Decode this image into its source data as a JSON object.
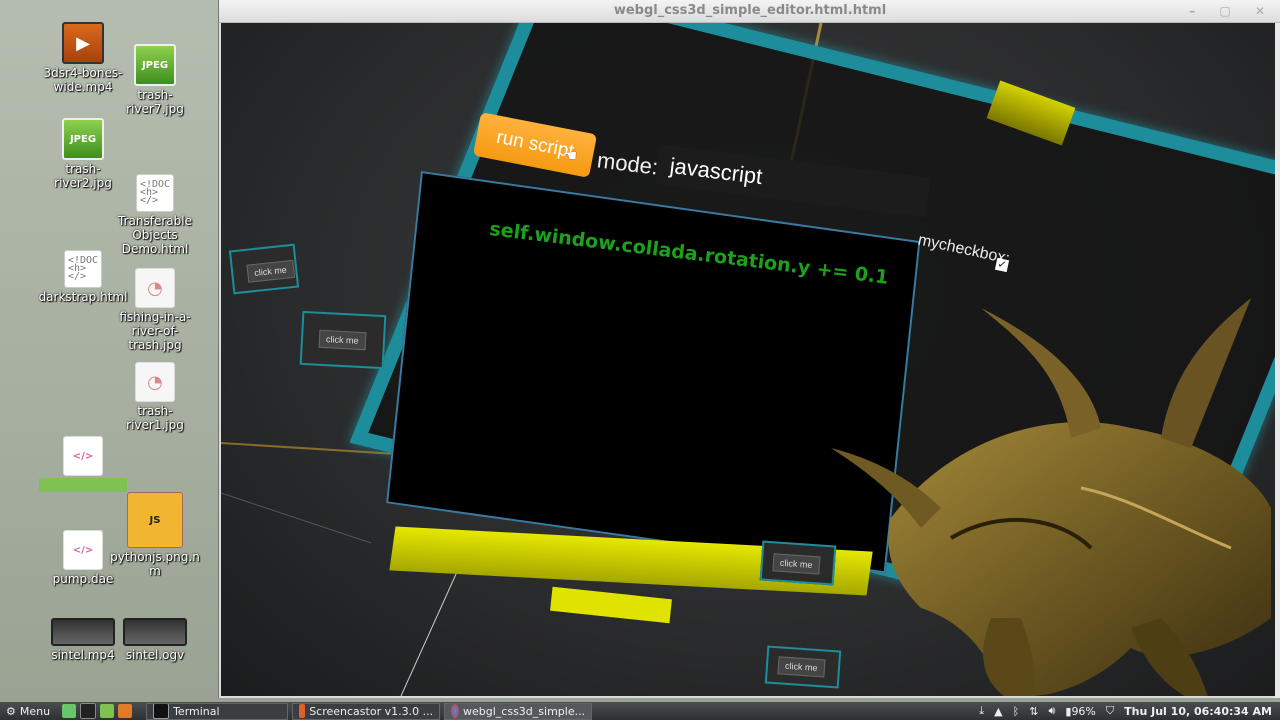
{
  "window": {
    "title": "webgl_css3d_simple_editor.html.html",
    "controls": "– ▢ ✕"
  },
  "desktop_icons": [
    {
      "label": "3dsr4-bones-wide.mp4",
      "type": "video"
    },
    {
      "label": "trash-river7.jpg",
      "type": "jpeg"
    },
    {
      "label": "trash-river2.jpg",
      "type": "jpeg"
    },
    {
      "label": "Transferable Objects Demo.html",
      "type": "doc"
    },
    {
      "label": "darkstrap.html",
      "type": "doc"
    },
    {
      "label": "fishing-in-a-river-of-trash.jpg",
      "type": "image"
    },
    {
      "label": "trash-river1.jpg",
      "type": "image"
    },
    {
      "label": "",
      "type": "code"
    },
    {
      "label": "pythonjs.png.nm",
      "type": "js"
    },
    {
      "label": "pump.dae",
      "type": "code"
    },
    {
      "label": "sintel.mp4",
      "type": "film"
    },
    {
      "label": "sintel.ogv",
      "type": "film"
    }
  ],
  "scene": {
    "run_button": "run script",
    "mode_label": "mode:",
    "mode_value": "javascript",
    "checkbox_label": "mycheckbox:",
    "checkbox_mark": "✓",
    "code": "self.window.collada.rotation.y += 0.1",
    "small_buttons": [
      "click me",
      "click me",
      "click me",
      "click me"
    ]
  },
  "taskbar": {
    "menu_label": "Menu",
    "tasks": [
      "Terminal",
      "Screencastor v1.3.0 ...",
      "webgl_css3d_simple..."
    ],
    "battery": "96%",
    "clock": "Thu Jul 10, 06:40:34 AM"
  },
  "colors": {
    "accent_orange": "#f59a12",
    "frame_teal": "#1d8c9b",
    "code_green": "#1ba11b",
    "yellow": "#e6e800"
  }
}
